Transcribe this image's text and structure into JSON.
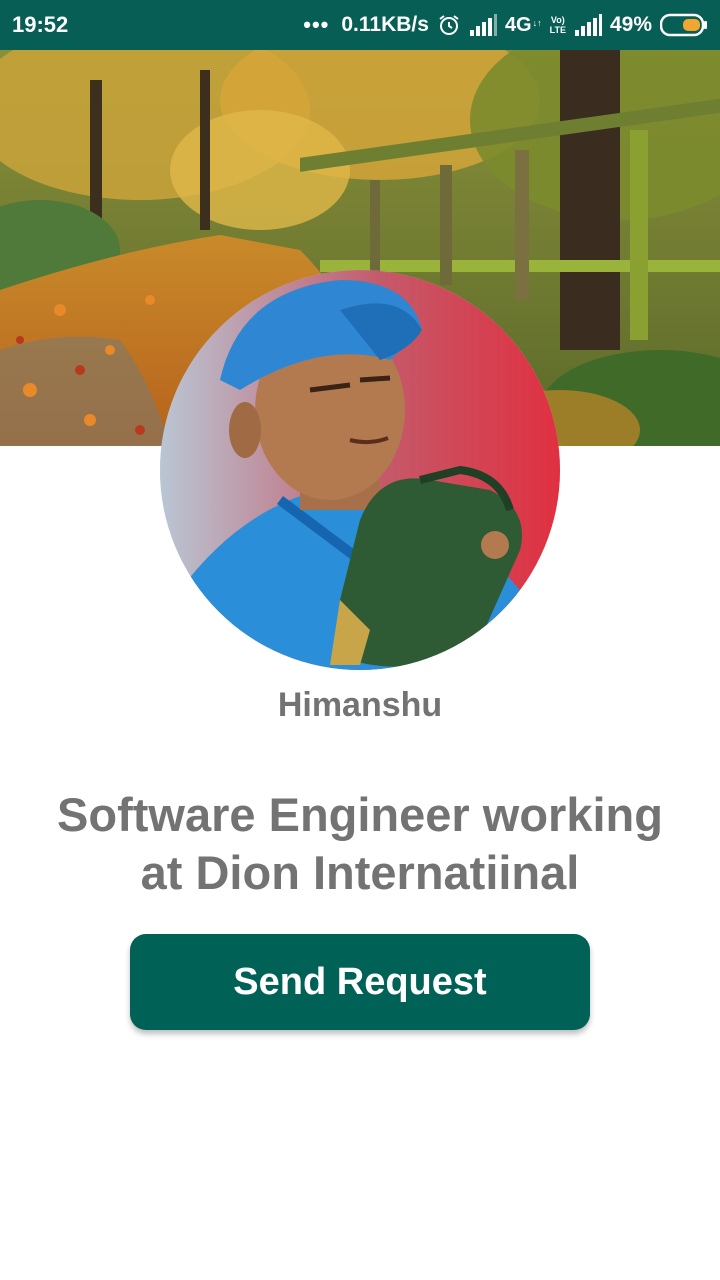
{
  "status_bar": {
    "time": "19:52",
    "dots": "•••",
    "net_speed": "0.11KB/s",
    "network_type": "4G",
    "network_sub": "↓↑",
    "volte_top": "Vo)",
    "volte_bottom": "LTE",
    "battery_percent": "49%",
    "icons": [
      "alarm-icon",
      "signal-icon",
      "volte-icon",
      "battery-icon"
    ],
    "background_color": "#075e54"
  },
  "cover": {
    "description_icon": "autumn-path-cover-image"
  },
  "profile": {
    "avatar_icon": "profile-photo",
    "name": "Himanshu",
    "status_line_1": "Software Engineer working",
    "status_line_2": "at Dion Internatiinal"
  },
  "actions": {
    "send_request_label": "Send Request",
    "button_color": "#006157"
  }
}
